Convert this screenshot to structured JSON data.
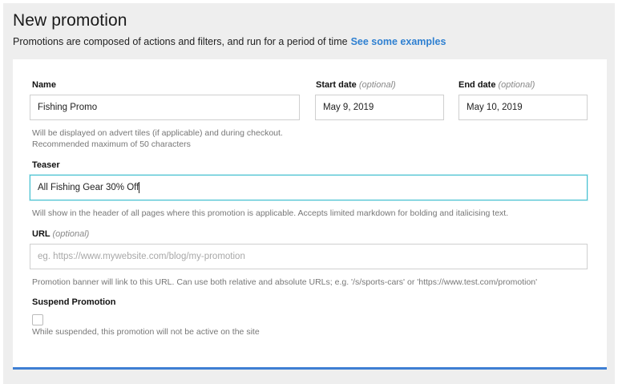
{
  "header": {
    "title": "New promotion",
    "subtitle": "Promotions are composed of actions and filters, and run for a period of time",
    "examples_link": "See some examples"
  },
  "form": {
    "name": {
      "label": "Name",
      "value": "Fishing Promo",
      "help_line1": "Will be displayed on advert tiles (if applicable) and during checkout.",
      "help_line2": "Recommended maximum of 50 characters"
    },
    "start_date": {
      "label": "Start date",
      "optional": "(optional)",
      "value": "May 9, 2019"
    },
    "end_date": {
      "label": "End date",
      "optional": "(optional)",
      "value": "May 10, 2019"
    },
    "teaser": {
      "label": "Teaser",
      "value": "All Fishing Gear 30% Off",
      "help": "Will show in the header of all pages where this promotion is applicable. Accepts limited markdown for bolding and italicising text."
    },
    "url": {
      "label": "URL",
      "optional": "(optional)",
      "placeholder": "eg. https://www.mywebsite.com/blog/my-promotion",
      "help": "Promotion banner will link to this URL. Can use both relative and absolute URLs; e.g. '/s/sports-cars' or 'https://www.test.com/promotion'"
    },
    "suspend": {
      "label": "Suspend Promotion",
      "checked": false,
      "help": "While suspended, this promotion will not be active on the site"
    }
  },
  "colors": {
    "accent_link": "#2f80d1",
    "focus_border": "#45c1d1",
    "bottom_bar": "#3e7fd3"
  }
}
